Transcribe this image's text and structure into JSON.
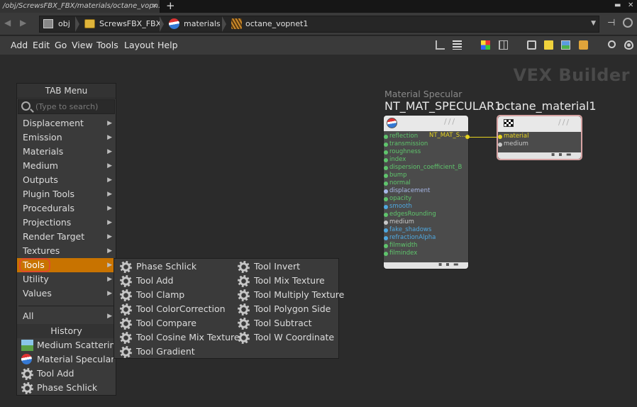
{
  "tab": {
    "title": "/obj/ScrewsFBX_FBX/materials/octane_vopn...",
    "close": "×",
    "add": "+"
  },
  "window": {
    "minimize": "▬",
    "close": "✕"
  },
  "path": {
    "back": "◀",
    "forward": "▶",
    "crumbs": [
      "obj",
      "ScrewsFBX_FBX",
      "materials",
      "octane_vopnet1"
    ],
    "dropdown": "▼"
  },
  "menubar": [
    "Add",
    "Edit",
    "Go",
    "View",
    "Tools",
    "Layout",
    "Help"
  ],
  "network": {
    "title": "VEX Builder"
  },
  "tab_menu": {
    "header": "TAB Menu",
    "search_placeholder": "(Type to search)",
    "categories": [
      "Displacement",
      "Emission",
      "Materials",
      "Medium",
      "Outputs",
      "Plugin Tools",
      "Procedurals",
      "Projections",
      "Render Target",
      "Textures",
      "Tools",
      "Utility",
      "Values"
    ],
    "all_label": "All",
    "history_header": "History",
    "history": [
      "Medium Scattering",
      "Material Specular",
      "Tool Add",
      "Phase Schlick"
    ]
  },
  "tools_submenu": {
    "col1": [
      "Phase Schlick",
      "Tool Add",
      "Tool Clamp",
      "Tool ColorCorrection",
      "Tool Compare",
      "Tool Cosine Mix Texture",
      "Tool Gradient"
    ],
    "col2": [
      "Tool Invert",
      "Tool Mix Texture",
      "Tool Multiply Texture",
      "Tool Polygon Side",
      "Tool Subtract",
      "Tool W Coordinate"
    ]
  },
  "nodes": {
    "specular": {
      "type_label": "Material Specular",
      "name": "NT_MAT_SPECULAR1",
      "output_label": "NT_MAT_S...",
      "inputs": [
        {
          "name": "reflection",
          "color": "#5fc46c"
        },
        {
          "name": "transmission",
          "color": "#5fc46c"
        },
        {
          "name": "roughness",
          "color": "#5fc46c"
        },
        {
          "name": "index",
          "color": "#5fc46c"
        },
        {
          "name": "dispersion_coefficient_B",
          "color": "#5fc46c"
        },
        {
          "name": "bump",
          "color": "#5fc46c"
        },
        {
          "name": "normal",
          "color": "#5fc46c"
        },
        {
          "name": "displacement",
          "color": "#a8b8e8"
        },
        {
          "name": "opacity",
          "color": "#5fc46c"
        },
        {
          "name": "smooth",
          "color": "#4fa8e0"
        },
        {
          "name": "edgesRounding",
          "color": "#5fc46c"
        },
        {
          "name": "medium",
          "color": "#c8c8c8"
        },
        {
          "name": "fake_shadows",
          "color": "#4fa8e0"
        },
        {
          "name": "refractionAlpha",
          "color": "#4fa8e0"
        },
        {
          "name": "filmwidth",
          "color": "#5fc46c"
        },
        {
          "name": "filmindex",
          "color": "#5fc46c"
        }
      ]
    },
    "octane": {
      "name": "octane_material1",
      "inputs": [
        {
          "name": "material",
          "color": "#e6d321"
        },
        {
          "name": "medium",
          "color": "#c8c8c8"
        }
      ]
    }
  }
}
